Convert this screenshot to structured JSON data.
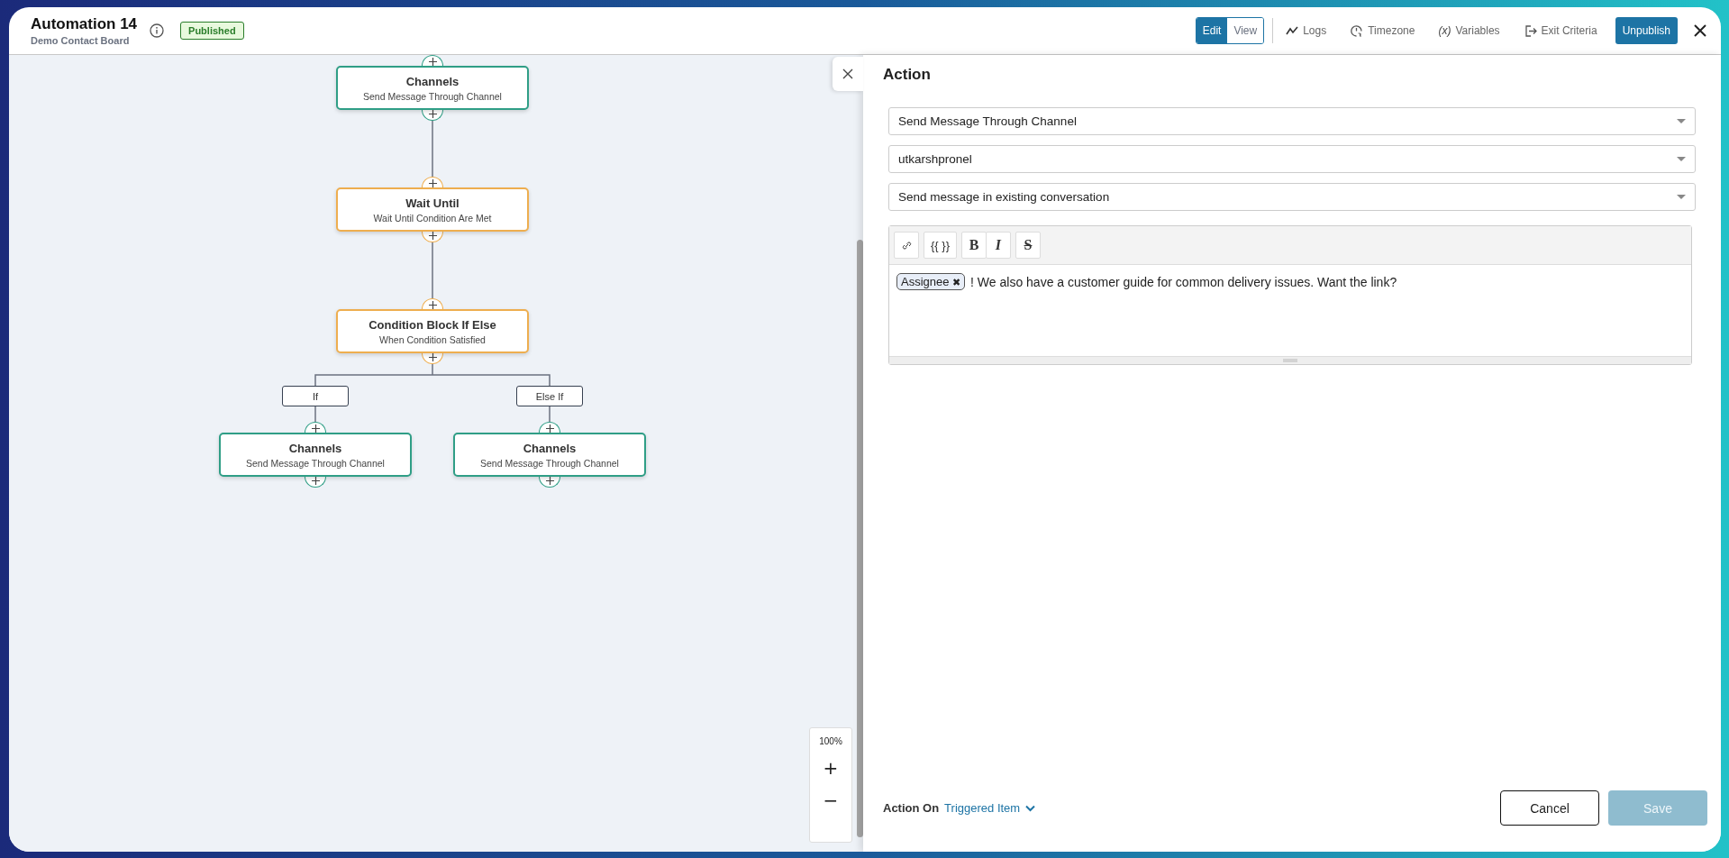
{
  "header": {
    "title": "Automation 14",
    "subtitle": "Demo Contact Board",
    "status": "Published",
    "mode_toggle": [
      {
        "label": "Edit",
        "selected": true
      },
      {
        "label": "View",
        "selected": false
      }
    ],
    "tools": [
      {
        "label": "Logs",
        "kind": "logs"
      },
      {
        "label": "Timezone",
        "kind": "timezone"
      },
      {
        "label": "Variables",
        "kind": "variables",
        "symbol": "(x)"
      },
      {
        "label": "Exit Criteria",
        "kind": "exit"
      }
    ],
    "primary_button": "Unpublish"
  },
  "flow": {
    "nodes": [
      {
        "title": "Channels",
        "subtitle": "Send Message Through Channel",
        "kind": "channel"
      },
      {
        "title": "Wait Until",
        "subtitle": "Wait Until Condition Are Met",
        "kind": "wait"
      },
      {
        "title": "Condition Block If Else",
        "subtitle": "When Condition Satisfied",
        "kind": "condition"
      }
    ],
    "branches": [
      {
        "label": "If",
        "node": {
          "title": "Channels",
          "subtitle": "Send Message Through Channel",
          "kind": "channel"
        }
      },
      {
        "label": "Else If",
        "node": {
          "title": "Channels",
          "subtitle": "Send Message Through Channel",
          "kind": "channel"
        }
      }
    ],
    "zoom": {
      "reading": "100%",
      "zoom_in": "+",
      "zoom_out": "−"
    }
  },
  "panel": {
    "title": "Action",
    "selects": [
      "Send Message Through Channel",
      "utkarshpronel",
      "Send message in existing conversation"
    ],
    "editor": {
      "toolbar": [
        {
          "kind": "link"
        },
        {
          "kind": "variable",
          "label": "{{ }}"
        },
        {
          "kind": "bold",
          "label": "B"
        },
        {
          "kind": "italic",
          "label": "I"
        },
        {
          "kind": "strike",
          "label": "S"
        }
      ],
      "chip": {
        "label": "Assignee",
        "remove": "✖"
      },
      "text": "! We also have a customer guide for common delivery issues. Want the link?"
    },
    "action_on": {
      "label": "Action On",
      "value": "Triggered Item"
    },
    "buttons": [
      {
        "label": "Cancel",
        "kind": "secondary",
        "disabled": false
      },
      {
        "label": "Save",
        "kind": "primary",
        "disabled": true
      }
    ]
  }
}
